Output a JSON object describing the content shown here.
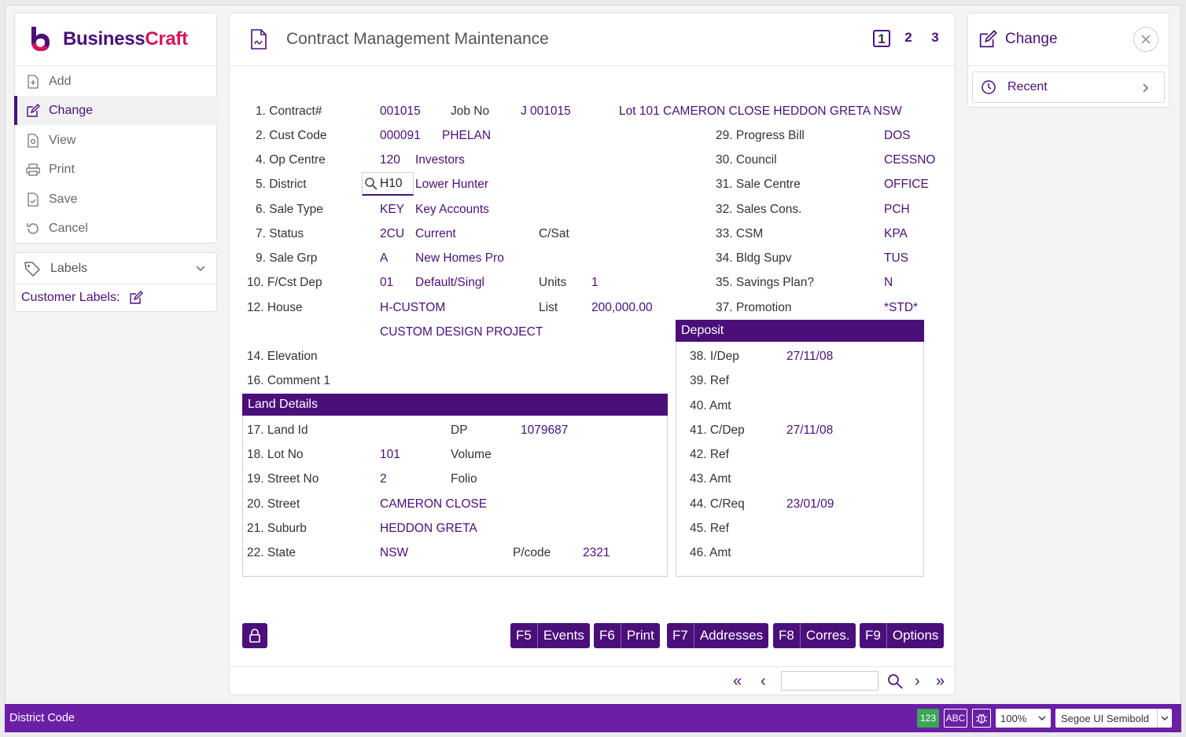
{
  "brand": {
    "name_a": "Business",
    "name_b": "Craft"
  },
  "sidebar": {
    "items": [
      {
        "label": "Add",
        "icon": "add-doc-icon"
      },
      {
        "label": "Change",
        "icon": "edit-icon"
      },
      {
        "label": "View",
        "icon": "view-doc-icon"
      },
      {
        "label": "Print",
        "icon": "print-icon"
      },
      {
        "label": "Save",
        "icon": "save-icon"
      },
      {
        "label": "Cancel",
        "icon": "undo-icon"
      }
    ],
    "labels_title": "Labels",
    "customer_labels": "Customer Labels:"
  },
  "header": {
    "title": "Contract Management Maintenance",
    "pages": [
      "1",
      "2",
      "3"
    ]
  },
  "right_panel": {
    "title": "Change",
    "recent": "Recent"
  },
  "form": {
    "contract_lbl": "1. Contract#",
    "contract_val": "001015",
    "jobno_lbl": "Job No",
    "jobno_val": "J 001015",
    "address": "Lot 101 CAMERON CLOSE HEDDON GRETA NSW",
    "cust_lbl": "2. Cust Code",
    "cust_val": "000091",
    "cust_name": "PHELAN",
    "op_lbl": "4. Op Centre",
    "op_val": "120",
    "op_name": "Investors",
    "district_lbl": "5. District",
    "district_val": "H10",
    "district_name": "Lower Hunter",
    "saletype_lbl": "6. Sale Type",
    "saletype_val": "KEY",
    "saletype_name": "Key Accounts",
    "status_lbl": "7. Status",
    "status_val": "2CU",
    "status_name": "Current",
    "csat_lbl": "C/Sat",
    "salegrp_lbl": "9. Sale Grp",
    "salegrp_val": "A",
    "salegrp_name": "New Homes Pro",
    "fcst_lbl": "10. F/Cst Dep",
    "fcst_val": "01",
    "fcst_name": "Default/Singl",
    "units_lbl": "Units",
    "units_val": "1",
    "house_lbl": "12. House",
    "house_val": "H-CUSTOM",
    "list_lbl": "List",
    "list_val": "200,000.00",
    "house_desc": "CUSTOM DESIGN PROJECT",
    "elev_lbl": "14. Elevation",
    "comment_lbl": "16. Comment 1",
    "progress_lbl": "29. Progress Bill",
    "progress_val": "DOS",
    "council_lbl": "30. Council",
    "council_val": "CESSNO",
    "salecentre_lbl": "31. Sale Centre",
    "salecentre_val": "OFFICE",
    "salescons_lbl": "32. Sales Cons.",
    "salescons_val": "PCH",
    "csm_lbl": "33. CSM",
    "csm_val": "KPA",
    "bldg_lbl": "34. Bldg Supv",
    "bldg_val": "TUS",
    "savings_lbl": "35. Savings Plan?",
    "savings_val": "N",
    "promo_lbl": "37. Promotion",
    "promo_val": "*STD*"
  },
  "land": {
    "title": "Land Details",
    "landid_lbl": "17. Land Id",
    "dp_lbl": "DP",
    "dp_val": "1079687",
    "lotno_lbl": "18. Lot No",
    "lotno_val": "101",
    "volume_lbl": "Volume",
    "streetno_lbl": "19. Street No",
    "streetno_val": "2",
    "folio_lbl": "Folio",
    "street_lbl": "20. Street",
    "street_val": "CAMERON CLOSE",
    "suburb_lbl": "21. Suburb",
    "suburb_val": "HEDDON GRETA",
    "state_lbl": "22. State",
    "state_val": "NSW",
    "pcode_lbl": "P/code",
    "pcode_val": "2321"
  },
  "deposit": {
    "title": "Deposit",
    "idep_lbl": "38. I/Dep",
    "idep_val": "27/11/08",
    "ref1_lbl": "39. Ref",
    "amt1_lbl": "40. Amt",
    "cdep_lbl": "41. C/Dep",
    "cdep_val": "27/11/08",
    "ref2_lbl": "42. Ref",
    "amt2_lbl": "43. Amt",
    "creq_lbl": "44. C/Req",
    "creq_val": "23/01/09",
    "ref3_lbl": "45. Ref",
    "amt3_lbl": "46. Amt"
  },
  "fkeys": [
    {
      "key": "F5",
      "label": "Events"
    },
    {
      "key": "F6",
      "label": "Print"
    },
    {
      "key": "F7",
      "label": "Addresses"
    },
    {
      "key": "F8",
      "label": "Corres."
    },
    {
      "key": "F9",
      "label": "Options"
    }
  ],
  "status_bar": {
    "text": "District Code",
    "num_chip": "123",
    "abc_chip": "ABC",
    "zoom": "100%",
    "font": "Segoe UI Semibold"
  },
  "colors": {
    "accent": "#4b0f7a",
    "status": "#6a1fa6",
    "num_chip": "#3aa657"
  }
}
